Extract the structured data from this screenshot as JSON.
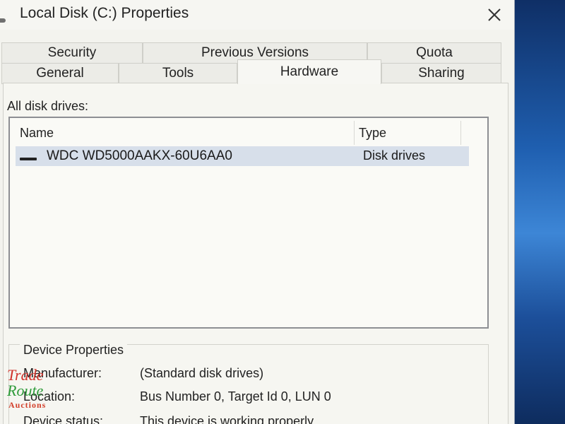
{
  "window": {
    "title": "Local Disk (C:) Properties",
    "close_symbol": "close-icon"
  },
  "tabs": {
    "row1": [
      {
        "label": "Security"
      },
      {
        "label": "Previous Versions"
      },
      {
        "label": "Quota"
      }
    ],
    "row2": [
      {
        "label": "General"
      },
      {
        "label": "Tools"
      },
      {
        "label": "Hardware",
        "active": true
      },
      {
        "label": "Sharing"
      }
    ]
  },
  "hardware": {
    "all_disks_label": "All disk drives:",
    "columns": {
      "name": "Name",
      "type": "Type"
    },
    "drives": [
      {
        "name": "WDC WD5000AAKX-60U6AA0",
        "type": "Disk drives",
        "icon": "disk-drive-icon",
        "selected": true
      }
    ],
    "device_properties": {
      "title": "Device Properties",
      "manufacturer_label": "Manufacturer:",
      "manufacturer_value": "(Standard disk drives)",
      "location_label": "Location:",
      "location_value": "Bus Number 0, Target Id 0, LUN 0",
      "status_label": "Device status:",
      "status_value": "This device is working properly."
    }
  },
  "watermark": {
    "line1": "Trade",
    "line2": "Route",
    "line3": "Auctions"
  },
  "colors": {
    "selection": "#d7dfea",
    "dialog_bg": "#f6f6f1",
    "desktop": "#1d4f8c"
  }
}
